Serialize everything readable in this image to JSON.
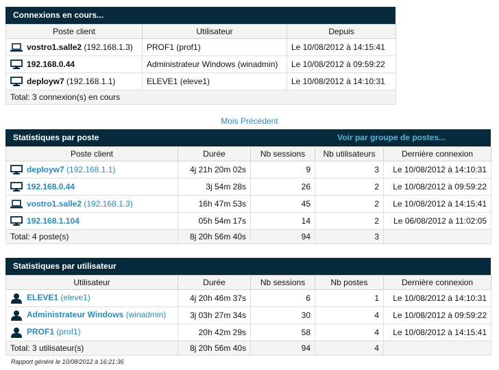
{
  "connections": {
    "title": "Connexions en cours...",
    "headers": [
      "Poste client",
      "Utilisateur",
      "Depuis"
    ],
    "rows": [
      {
        "host": "vostro1.salle2",
        "ip": "(192.168.1.3)",
        "icon": "laptop-icon",
        "user": "PROF1 (prof1)",
        "since": "Le 10/08/2012 à 14:15:41"
      },
      {
        "host": "192.168.0.44",
        "ip": "",
        "icon": "desktop-icon",
        "user": "Administrateur Windows (winadmin)",
        "since": "Le 10/08/2012 à 09:59:22"
      },
      {
        "host": "deployw7",
        "ip": "(192.168.1.1)",
        "icon": "desktop-icon",
        "user": "ELEVE1 (eleve1)",
        "since": "Le 10/08/2012 à 14:10:31"
      }
    ],
    "total": "Total: 3 connexion(s) en cours"
  },
  "prev_month_link": "Mois Précédent",
  "by_host": {
    "title": "Statistiques par poste",
    "group_link": "Voir par groupe de postes...",
    "headers": [
      "Poste client",
      "Durée",
      "Nb sessions",
      "Nb utilisateurs",
      "Dernière connexion"
    ],
    "rows": [
      {
        "host": "deployw7",
        "ip": "(192.168.1.1)",
        "icon": "desktop-icon",
        "duration": "4j 21h 20m 02s",
        "sessions": "9",
        "users": "3",
        "last": "Le 10/08/2012 à 14:10:31"
      },
      {
        "host": "192.168.0.44",
        "ip": "",
        "icon": "desktop-icon",
        "duration": "3j 54m 28s",
        "sessions": "26",
        "users": "2",
        "last": "Le 10/08/2012 à 09:59:22"
      },
      {
        "host": "vostro1.salle2",
        "ip": "(192.168.1.3)",
        "icon": "laptop-icon",
        "duration": "16h 47m 53s",
        "sessions": "45",
        "users": "2",
        "last": "Le 10/08/2012 à 14:15:41"
      },
      {
        "host": "192.168.1.104",
        "ip": "",
        "icon": "desktop-icon",
        "duration": "05h 54m 17s",
        "sessions": "14",
        "users": "2",
        "last": "Le 06/08/2012 à 11:02:05"
      }
    ],
    "total": {
      "label": "Total: 4 poste(s)",
      "duration": "8j 20h 56m 40s",
      "sessions": "94",
      "users": "3",
      "last": ""
    }
  },
  "by_user": {
    "title": "Statistiques par utilisateur",
    "headers": [
      "Utilisateur",
      "Durée",
      "Nb sessions",
      "Nb postes",
      "Dernière connexion"
    ],
    "rows": [
      {
        "name": "ELEVE1",
        "login": "(eleve1)",
        "icon": "user-icon",
        "duration": "4j 20h 46m 37s",
        "sessions": "6",
        "hosts": "1",
        "last": "Le 10/08/2012 à 14:10:31"
      },
      {
        "name": "Administrateur Windows",
        "login": "(winadmin)",
        "icon": "user-icon",
        "duration": "3j 03h 27m 34s",
        "sessions": "30",
        "hosts": "4",
        "last": "Le 10/08/2012 à 09:59:22"
      },
      {
        "name": "PROF1",
        "login": "(prof1)",
        "icon": "user-icon",
        "duration": "20h 42m 29s",
        "sessions": "58",
        "hosts": "4",
        "last": "Le 10/08/2012 à 14:15:41"
      }
    ],
    "total": {
      "label": "Total: 3 utilisateur(s)",
      "duration": "8j 20h 56m 40s",
      "sessions": "94",
      "hosts": "4",
      "last": ""
    }
  },
  "footer": "Rapport généré le 10/08/2012 à 16:21:36",
  "colors": {
    "header_bg": "#062a3c",
    "link": "#2a8ab8",
    "head_link": "#58b4d6"
  }
}
